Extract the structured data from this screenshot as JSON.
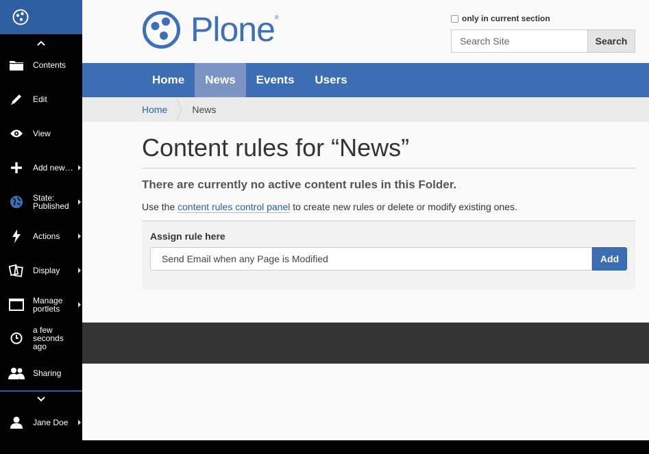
{
  "toolbar": {
    "items": [
      {
        "label": "Contents",
        "icon": "folder-icon"
      },
      {
        "label": "Edit",
        "icon": "pencil-icon"
      },
      {
        "label": "View",
        "icon": "eye-icon"
      },
      {
        "label": "Add new…",
        "icon": "plus-icon"
      },
      {
        "label": "State: Published",
        "icon": "globe-icon"
      },
      {
        "label": "Actions",
        "icon": "lightning-icon"
      },
      {
        "label": "Display",
        "icon": "display-icon"
      },
      {
        "label": "Manage portlets",
        "icon": "window-icon"
      },
      {
        "label": "a few seconds ago",
        "icon": "clock-icon"
      },
      {
        "label": "Sharing",
        "icon": "users-icon"
      }
    ],
    "user": {
      "label": "Jane Doe",
      "icon": "user-icon"
    }
  },
  "header": {
    "brand": "Plone",
    "brand_mark": "®",
    "search_option": "only in current section",
    "search_placeholder": "Search Site",
    "search_button": "Search"
  },
  "nav": {
    "tabs": [
      "Home",
      "News",
      "Events",
      "Users"
    ],
    "active": "News"
  },
  "breadcrumb": {
    "home": "Home",
    "current": "News"
  },
  "main": {
    "title": "Content rules for “News”",
    "notice": "There are currently no active content rules in this Folder.",
    "info_pre": "Use the ",
    "info_link": "content rules control panel",
    "info_post": " to create new rules or delete or modify existing ones.",
    "assign_label": "Assign rule here",
    "assign_value": "Send Email when any Page is Modified",
    "assign_button": "Add"
  },
  "colors": {
    "brand_blue": "#3d70b6",
    "nav_blue": "#3d6db3",
    "nav_active": "#7c94c4",
    "toolbar_bg": "#000000",
    "footer_bg": "#333333"
  }
}
